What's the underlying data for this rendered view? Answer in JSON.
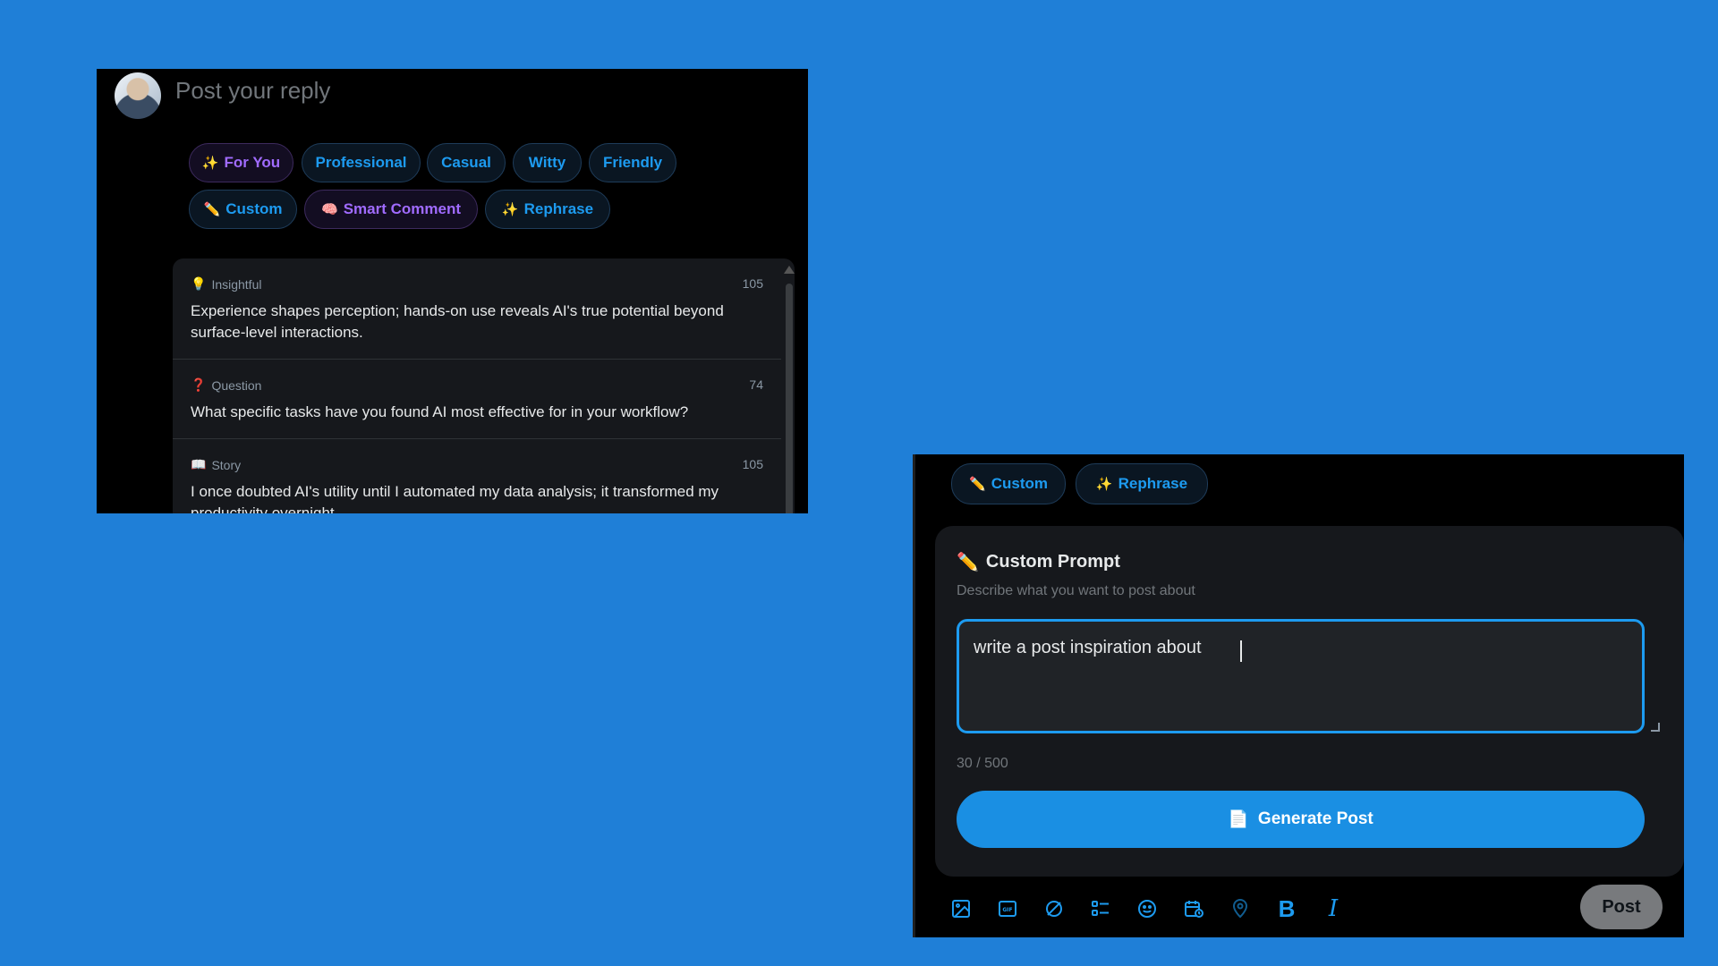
{
  "reply": {
    "placeholder": "Post your reply",
    "chips": [
      {
        "label": "For You",
        "icon": "sparkles-icon",
        "glyph": "✨"
      },
      {
        "label": "Professional"
      },
      {
        "label": "Casual"
      },
      {
        "label": "Witty"
      },
      {
        "label": "Friendly"
      },
      {
        "label": "Custom",
        "icon": "pencil-icon",
        "glyph": "✏️"
      },
      {
        "label": "Smart Comment",
        "icon": "brain-icon",
        "glyph": "🧠"
      },
      {
        "label": "Rephrase",
        "icon": "sparkles-icon",
        "glyph": "✨"
      }
    ],
    "suggestions": [
      {
        "type": "Insightful",
        "icon": "lightbulb-icon",
        "glyph": "💡",
        "count": "105",
        "text": "Experience shapes perception; hands-on use reveals AI's true potential beyond surface-level interactions."
      },
      {
        "type": "Question",
        "icon": "question-icon",
        "glyph": "❓",
        "count": "74",
        "text": "What specific tasks have you found AI most effective for in your workflow?"
      },
      {
        "type": "Story",
        "icon": "book-icon",
        "glyph": "📖",
        "count": "105",
        "text": "I once doubted AI's utility until I automated my data analysis; it transformed my productivity overnight."
      }
    ]
  },
  "compose": {
    "chips": [
      {
        "label": "Custom",
        "icon": "pencil-icon",
        "glyph": "✏️"
      },
      {
        "label": "Rephrase",
        "icon": "sparkles-icon",
        "glyph": "✨"
      }
    ],
    "prompt": {
      "title": "Custom Prompt",
      "title_glyph": "✏️",
      "subtitle": "Describe what you want to post about",
      "value": "write a post inspiration about",
      "counter": "30 / 500",
      "generate_label": "Generate Post",
      "generate_glyph": "📄"
    },
    "post_label": "Post"
  },
  "colors": {
    "background": "#1f7fd7",
    "accent": "#1d9bf0",
    "purple_accent": "#a06bff",
    "panel": "#000000"
  }
}
